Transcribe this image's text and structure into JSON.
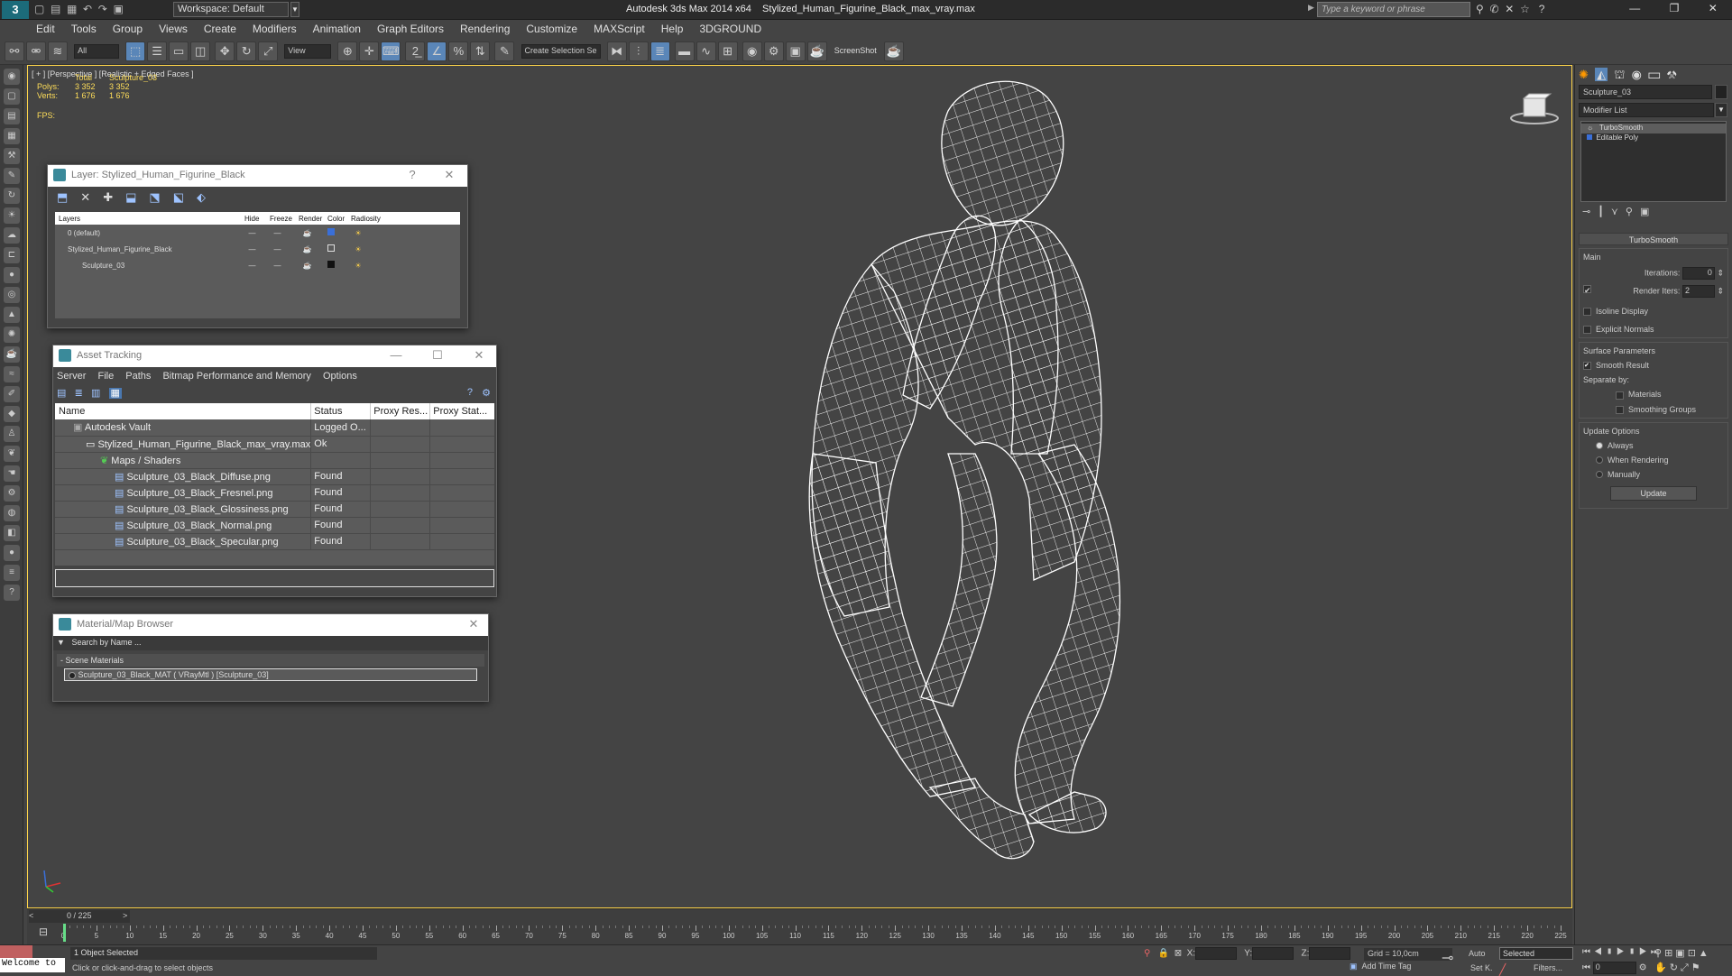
{
  "app": {
    "title": "Autodesk 3ds Max  2014 x64",
    "file": "Stylized_Human_Figurine_Black_max_vray.max",
    "workspace": "Workspace: Default",
    "search_placeholder": "Type a keyword or phrase",
    "window_controls": [
      "—",
      "❐",
      "✕"
    ]
  },
  "menu": [
    "Edit",
    "Tools",
    "Group",
    "Views",
    "Create",
    "Modifiers",
    "Animation",
    "Graph Editors",
    "Rendering",
    "Customize",
    "MAXScript",
    "Help",
    "3DGROUND"
  ],
  "toolbar": {
    "filter": "All",
    "view": "View",
    "selection_set": "Create Selection Se",
    "screenshot": "ScreenShot"
  },
  "viewport": {
    "label": "[ + ] [Perspective ] [Realistic + Edged Faces ]",
    "stats": {
      "header_total": "Total",
      "header_obj": "Sculpture_03",
      "polys_label": "Polys:",
      "polys_total": "3 352",
      "polys_obj": "3 352",
      "verts_label": "Verts:",
      "verts_total": "1 676",
      "verts_obj": "1 676",
      "fps_label": "FPS:"
    }
  },
  "layer_window": {
    "title": "Layer: Stylized_Human_Figurine_Black",
    "help": "?",
    "columns": [
      "Layers",
      "Hide",
      "Freeze",
      "Render",
      "Color",
      "Radiosity"
    ],
    "rows": [
      {
        "name": "0 (default)",
        "indent": 0
      },
      {
        "name": "Stylized_Human_Figurine_Black",
        "indent": 0
      },
      {
        "name": "Sculpture_03",
        "indent": 1
      }
    ]
  },
  "asset_window": {
    "title": "Asset Tracking",
    "menu": [
      "Server",
      "File",
      "Paths",
      "Bitmap Performance and Memory",
      "Options"
    ],
    "columns": [
      "Name",
      "Status",
      "Proxy Res...",
      "Proxy Stat..."
    ],
    "rows": [
      {
        "name": "Autodesk Vault",
        "status": "Logged O...",
        "indent": 0
      },
      {
        "name": "Stylized_Human_Figurine_Black_max_vray.max",
        "status": "Ok",
        "indent": 1
      },
      {
        "name": "Maps / Shaders",
        "status": "",
        "indent": 2
      },
      {
        "name": "Sculpture_03_Black_Diffuse.png",
        "status": "Found",
        "indent": 3
      },
      {
        "name": "Sculpture_03_Black_Fresnel.png",
        "status": "Found",
        "indent": 3
      },
      {
        "name": "Sculpture_03_Black_Glossiness.png",
        "status": "Found",
        "indent": 3
      },
      {
        "name": "Sculpture_03_Black_Normal.png",
        "status": "Found",
        "indent": 3
      },
      {
        "name": "Sculpture_03_Black_Specular.png",
        "status": "Found",
        "indent": 3
      }
    ]
  },
  "material_window": {
    "title": "Material/Map Browser",
    "search": "Search by Name ...",
    "section": "- Scene Materials",
    "item": "Sculpture_03_Black_MAT  ( VRayMtl )  [Sculpture_03]"
  },
  "command_panel": {
    "object_name": "Sculpture_03",
    "modifier_list": "Modifier List",
    "stack": [
      "TurboSmooth",
      "Editable Poly"
    ],
    "rollout": "TurboSmooth",
    "main": "Main",
    "iterations_label": "Iterations:",
    "iterations": "0",
    "render_iters_label": "Render Iters:",
    "render_iters": "2",
    "isoline": "Isoline Display",
    "explicit": "Explicit Normals",
    "surface": "Surface Parameters",
    "smooth": "Smooth Result",
    "separate": "Separate by:",
    "materials": "Materials",
    "smoothing": "Smoothing Groups",
    "update_options": "Update Options",
    "always": "Always",
    "when_rendering": "When Rendering",
    "manually": "Manually",
    "update_btn": "Update"
  },
  "timeline": {
    "frame": "0 / 225",
    "ticks": [
      "0",
      "5",
      "10",
      "15",
      "20",
      "25",
      "30",
      "35",
      "40",
      "45",
      "50",
      "55",
      "60",
      "65",
      "70",
      "75",
      "80",
      "85",
      "90",
      "95",
      "100",
      "105",
      "110",
      "115",
      "120",
      "125",
      "130",
      "135",
      "140",
      "145",
      "150",
      "155",
      "160",
      "165",
      "170",
      "175",
      "180",
      "185",
      "190",
      "195",
      "200",
      "205",
      "210",
      "215",
      "220",
      "225"
    ]
  },
  "status": {
    "welcome": "Welcome to",
    "selected": "1 Object Selected",
    "hint": "Click or click-and-drag to select objects",
    "x": "X:",
    "y": "Y:",
    "z": "Z:",
    "grid": "Grid = 10,0cm",
    "add_time_tag": "Add Time Tag",
    "auto": "Auto",
    "sel_mode": "Selected",
    "setk": "Set K.",
    "filters": "Filters...",
    "frame": "0"
  }
}
